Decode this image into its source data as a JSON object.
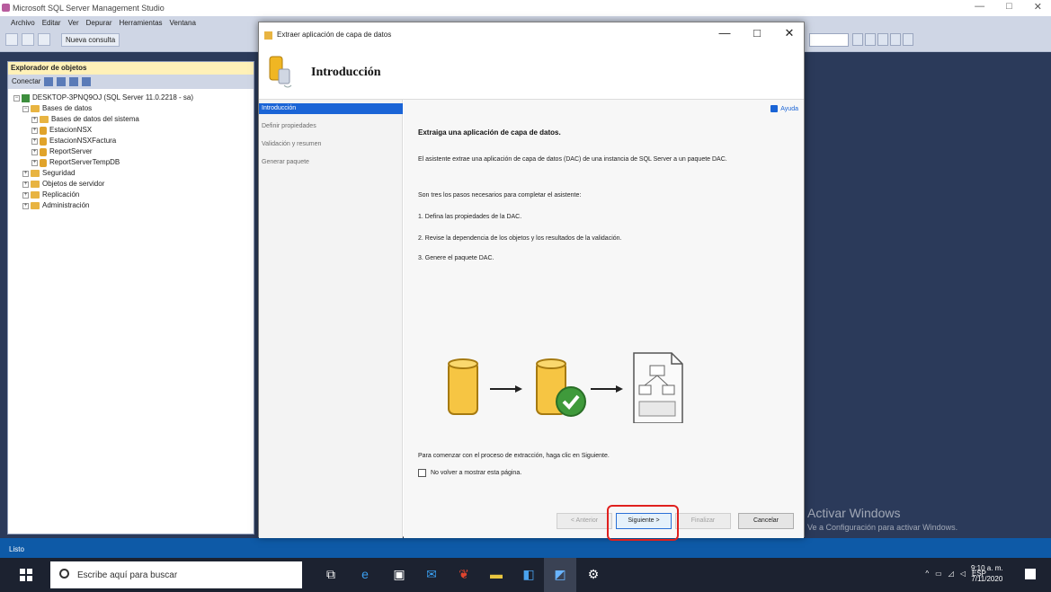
{
  "ssms": {
    "title": "Microsoft SQL Server Management Studio",
    "menu": [
      "Archivo",
      "Editar",
      "Ver",
      "Depurar",
      "Herramientas",
      "Ventana"
    ],
    "new_query_label": "Nueva consulta",
    "status": "Listo"
  },
  "object_explorer": {
    "header": "Explorador de objetos",
    "connect_label": "Conectar",
    "tree": [
      {
        "label": "DESKTOP-3PNQ9OJ (SQL Server 11.0.2218 - sa)",
        "level": 0,
        "icon": "server"
      },
      {
        "label": "Bases de datos",
        "level": 1,
        "icon": "folder"
      },
      {
        "label": "Bases de datos del sistema",
        "level": 2,
        "icon": "folder"
      },
      {
        "label": "EstacionNSX",
        "level": 2,
        "icon": "database"
      },
      {
        "label": "EstacionNSXFactura",
        "level": 2,
        "icon": "database"
      },
      {
        "label": "ReportServer",
        "level": 2,
        "icon": "database"
      },
      {
        "label": "ReportServerTempDB",
        "level": 2,
        "icon": "database"
      },
      {
        "label": "Seguridad",
        "level": 1,
        "icon": "folder"
      },
      {
        "label": "Objetos de servidor",
        "level": 1,
        "icon": "folder"
      },
      {
        "label": "Replicación",
        "level": 1,
        "icon": "folder"
      },
      {
        "label": "Administración",
        "level": 1,
        "icon": "folder"
      }
    ]
  },
  "dialog": {
    "title": "Extraer aplicación de capa de datos",
    "header_title": "Introducción",
    "nav": [
      "Introducción",
      "Definir propiedades",
      "Validación y resumen",
      "Generar paquete"
    ],
    "help_label": "Ayuda",
    "heading": "Extraiga una aplicación de capa de datos.",
    "para1": "El asistente extrae una aplicación de capa de datos (DAC) de una instancia de SQL Server a un paquete DAC.",
    "para2": "Son tres los pasos necesarios para completar el asistente:",
    "step1": "1. Defina las propiedades de la DAC.",
    "step2": "2. Revise la dependencia de los objetos y los resultados de la validación.",
    "step3": "3. Genere el paquete DAC.",
    "footer_text": "Para comenzar con el proceso de extracción, haga clic en Siguiente.",
    "checkbox_label": "No volver a mostrar esta página.",
    "btn_back": "< Anterior",
    "btn_next": "Siguiente >",
    "btn_finish": "Finalizar",
    "btn_cancel": "Cancelar"
  },
  "watermark": {
    "line1": "Activar Windows",
    "line2": "Ve a Configuración para activar Windows."
  },
  "taskbar": {
    "search_placeholder": "Escribe aquí para buscar",
    "lang": "ESP",
    "time": "9:10 a. m.",
    "date": "7/11/2020"
  }
}
